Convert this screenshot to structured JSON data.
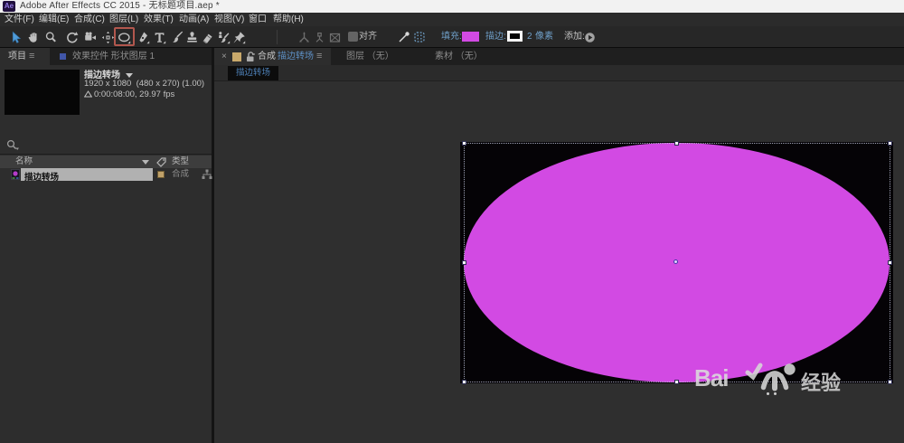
{
  "title_bar": {
    "app": "Ae",
    "title": "Adobe After Effects CC 2015 - 无标题项目.aep *"
  },
  "menu_bar": {
    "items": [
      "文件(F)",
      "编辑(E)",
      "合成(C)",
      "图层(L)",
      "效果(T)",
      "动画(A)",
      "视图(V)",
      "窗口",
      "帮助(H)"
    ]
  },
  "toolbar": {
    "tools": [
      "selection-tool",
      "hand-tool",
      "zoom-tool",
      "rotate-tool",
      "camera-tool",
      "pan-behind-tool",
      "ellipse-tool",
      "pen-tool",
      "text-tool",
      "brush-tool",
      "clone-stamp-tool",
      "eraser-tool",
      "roto-brush-tool",
      "puppet-pin-tool"
    ],
    "active_tool": "selection-tool",
    "highlighted_tool": "ellipse-tool",
    "snap_label": "对齐",
    "fill_label": "填充:",
    "fill_color": "#d24ae3",
    "stroke_label": "描边:",
    "stroke_width": "2",
    "stroke_unit": "像素",
    "add_label": "添加:"
  },
  "project_panel": {
    "tab": "项目",
    "effect_controls_tab": "效果控件 形状图层 1",
    "preview": {
      "name": "描边转场",
      "dims": "1920 x 1080  (480 x 270) (1.00)",
      "duration": "0:00:08:00, 29.97 fps"
    },
    "columns": {
      "name": "名称",
      "type": "类型"
    },
    "items": [
      {
        "name": "描边转场",
        "type": "合成",
        "selected": true
      }
    ]
  },
  "comp_panel": {
    "close": "×",
    "comp_label": "合成",
    "comp_name": "描边转场",
    "menu_icon": "≡",
    "other_tabs": [
      "图层 （无）",
      "素材 （无）"
    ],
    "nav_tab": "描边转场"
  },
  "viewport": {
    "shape": {
      "type": "ellipse",
      "fill": "#d24ae3"
    },
    "watermark": {
      "text1": "Bai",
      "text2": "经验"
    }
  }
}
